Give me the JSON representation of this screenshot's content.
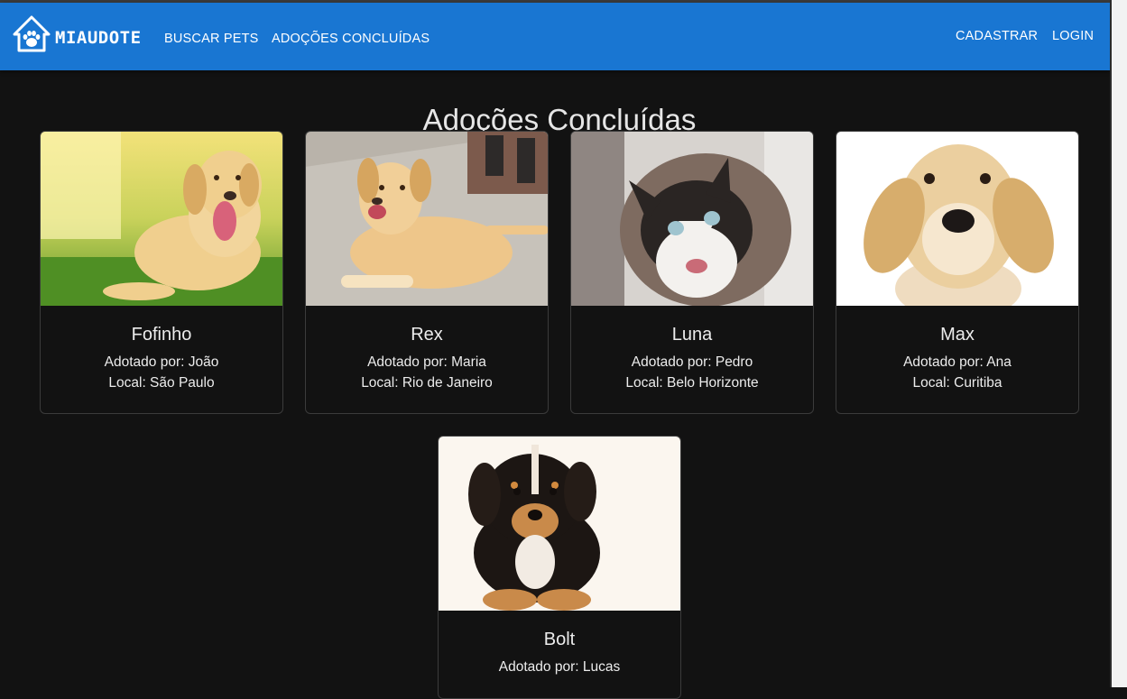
{
  "header": {
    "brand": "MIAUDOTE",
    "nav": [
      "BUSCAR PETS",
      "ADOÇÕES CONCLUÍDAS"
    ],
    "right": [
      "CADASTRAR",
      "LOGIN"
    ],
    "bar_color": "#1976d2"
  },
  "page": {
    "title": "Adoções Concluídas"
  },
  "adoptions": [
    {
      "name": "Fofinho",
      "adopter": "Adotado por: João",
      "location": "Local: São Paulo"
    },
    {
      "name": "Rex",
      "adopter": "Adotado por: Maria",
      "location": "Local: Rio de Janeiro"
    },
    {
      "name": "Luna",
      "adopter": "Adotado por: Pedro",
      "location": "Local: Belo Horizonte"
    },
    {
      "name": "Max",
      "adopter": "Adotado por: Ana",
      "location": "Local: Curitiba"
    },
    {
      "name": "Bolt",
      "adopter": "Adotado por: Lucas",
      "location": ""
    }
  ]
}
